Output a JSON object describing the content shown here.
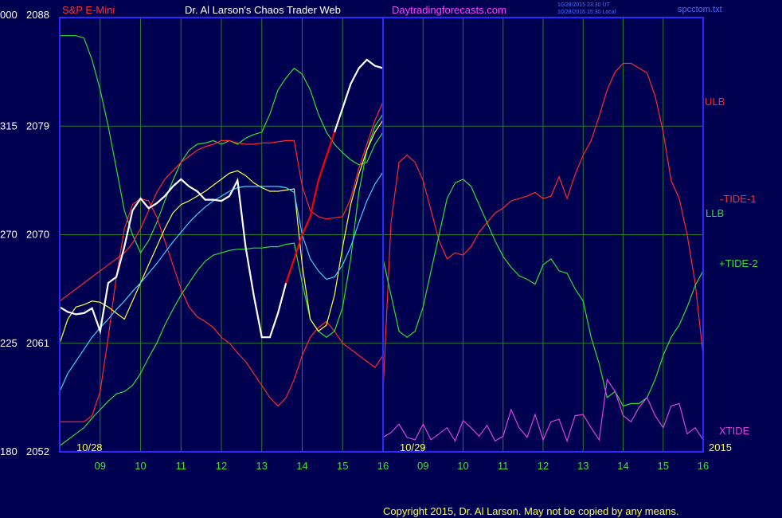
{
  "header": {
    "instrument": "S&P E-Mini",
    "title": "Dr. Al Larson's Chaos Trader Web",
    "site": "Daytradingforecasts.com",
    "timestamp1": "10/28/2015 23:30 UT",
    "timestamp2": "10/28/2015 15:30 Local",
    "filename": "spcctom.txt"
  },
  "footer": {
    "copyright": "Copyright 2015, Dr. Al Larson. May not be copied by any means."
  },
  "colors": {
    "background": "#000050",
    "plot_border": "#2a2aff",
    "grid": "#2a7a2a",
    "price_up": "#ffffff",
    "price_down": "#ff0000",
    "ulb": "#ff2a2a",
    "llb": "#30e030",
    "tide1": "#ff2a2a",
    "tide2": "#30e030",
    "xtide": "#e040e0",
    "ma_fast": "#ffff40",
    "ma_slow": "#40d0ff",
    "instrument_label": "#ff3030",
    "title_label": "#ffffff",
    "site_label": "#ff40ff",
    "axis_label": "#ffffff",
    "time_label": "#40e040"
  },
  "chart_data": {
    "type": "line",
    "title": "Dr. Al Larson's Chaos Trader Web",
    "y_ticks": [
      {
        "left": "000",
        "right": "2088",
        "value": 2088
      },
      {
        "left": "315",
        "right": "2079",
        "value": 2079
      },
      {
        "left": "270",
        "right": "2070",
        "value": 2070
      },
      {
        "left": "225",
        "right": "2061",
        "value": 2061
      },
      {
        "left": "180",
        "right": "2052",
        "value": 2052
      }
    ],
    "ylim": [
      2052,
      2088
    ],
    "xlim": [
      8.1,
      16.0
    ],
    "divider_x": 8.1,
    "dates": [
      {
        "label": "10/28",
        "x": 8.3
      },
      {
        "label": "10/29",
        "x": 8.4
      },
      {
        "label": "2015",
        "x": 16.0
      }
    ],
    "x_ticks_day1": [
      "09",
      "10",
      "11",
      "12",
      "13",
      "14",
      "15",
      "16"
    ],
    "x_ticks_day2": [
      "09",
      "10",
      "11",
      "12",
      "13",
      "14",
      "15",
      "16"
    ],
    "series": [
      {
        "name": "ULB",
        "color_key": "ulb",
        "day": 2,
        "x": [
          8.0,
          8.2,
          8.4,
          8.6,
          8.8,
          9.0,
          9.2,
          9.4,
          9.6,
          9.8,
          10.0,
          10.2,
          10.4,
          10.6,
          10.8,
          11.0,
          11.2,
          11.4,
          11.6,
          11.8,
          12.0,
          12.2,
          12.4,
          12.6,
          12.8,
          13.0,
          13.2,
          13.4,
          13.6,
          13.8,
          14.0,
          14.2,
          14.4,
          14.6,
          14.8,
          15.0,
          15.2,
          15.4,
          15.6,
          15.8,
          16.0
        ],
        "y": [
          2057.0,
          2071.0,
          2076.0,
          2076.6,
          2076.0,
          2074.5,
          2072.0,
          2069.5,
          2068.0,
          2068.5,
          2068.3,
          2069.0,
          2070.2,
          2071.0,
          2071.8,
          2072.2,
          2072.8,
          2073.0,
          2073.2,
          2073.5,
          2073.0,
          2073.2,
          2074.8,
          2073.0,
          2075.0,
          2076.6,
          2077.8,
          2079.8,
          2082.0,
          2083.5,
          2084.2,
          2084.2,
          2083.8,
          2083.4,
          2081.5,
          2078.5,
          2074.5,
          2073.0,
          2070.0,
          2066.0,
          2060.0
        ]
      },
      {
        "name": "LLB",
        "color_key": "llb",
        "day": 2,
        "x": [
          8.0,
          8.2,
          8.4,
          8.6,
          8.8,
          9.0,
          9.2,
          9.4,
          9.6,
          9.8,
          10.0,
          10.2,
          10.4,
          10.6,
          10.8,
          11.0,
          11.2,
          11.4,
          11.6,
          11.8,
          12.0,
          12.2,
          12.4,
          12.6,
          12.8,
          13.0,
          13.2,
          13.4,
          13.6,
          13.8,
          14.0,
          14.2,
          14.4,
          14.6,
          14.8,
          15.0,
          15.2,
          15.4,
          15.6,
          15.8,
          16.0
        ],
        "y": [
          2068.0,
          2065.0,
          2062.0,
          2061.5,
          2062.0,
          2064.0,
          2067.0,
          2070.0,
          2073.0,
          2074.3,
          2074.6,
          2074.0,
          2072.5,
          2071.0,
          2069.5,
          2068.2,
          2067.3,
          2066.6,
          2066.3,
          2065.9,
          2067.5,
          2068.0,
          2067.0,
          2066.8,
          2065.5,
          2064.5,
          2061.5,
          2059.3,
          2056.5,
          2057.0,
          2055.8,
          2056.0,
          2056.0,
          2056.5,
          2058.0,
          2060.0,
          2061.5,
          2062.5,
          2064.0,
          2065.8,
          2067.0
        ]
      },
      {
        "name": "XTIDE",
        "color_key": "xtide",
        "day": 2,
        "x": [
          8.0,
          8.2,
          8.4,
          8.6,
          8.8,
          9.0,
          9.2,
          9.4,
          9.6,
          9.8,
          10.0,
          10.2,
          10.4,
          10.6,
          10.8,
          11.0,
          11.2,
          11.4,
          11.6,
          11.8,
          12.0,
          12.2,
          12.4,
          12.6,
          12.8,
          13.0,
          13.2,
          13.4,
          13.6,
          13.8,
          14.0,
          14.2,
          14.4,
          14.6,
          14.8,
          15.0,
          15.2,
          15.4,
          15.6,
          15.8,
          16.0
        ],
        "y": [
          2053.2,
          2053.6,
          2054.3,
          2053.2,
          2053.0,
          2054.3,
          2053.0,
          2053.5,
          2054.0,
          2052.9,
          2054.6,
          2054.0,
          2053.3,
          2054.2,
          2052.9,
          2053.3,
          2055.5,
          2054.0,
          2053.2,
          2055.1,
          2053.0,
          2054.5,
          2054.7,
          2052.9,
          2055.0,
          2055.1,
          2054.0,
          2053.0,
          2058.0,
          2057.0,
          2055.0,
          2054.5,
          2055.7,
          2056.5,
          2055.0,
          2054.0,
          2055.8,
          2056.0,
          2053.5,
          2054.0,
          2053.0
        ]
      },
      {
        "name": "+TIDE-2",
        "color_key": "llb",
        "day": 1,
        "x": [
          8.0,
          8.2,
          8.4,
          8.6,
          8.8,
          9.0,
          9.2,
          9.4,
          9.6,
          9.8,
          10.0,
          10.2,
          10.4,
          10.6,
          10.8,
          11.0,
          11.2,
          11.4,
          11.6,
          11.8,
          12.0,
          12.2,
          12.4,
          12.6,
          12.8,
          13.0,
          13.2,
          13.4,
          13.6,
          13.8,
          14.0,
          14.2,
          14.4,
          14.6,
          14.8,
          15.0,
          15.2,
          15.4,
          15.6,
          15.8,
          16.0
        ],
        "y": [
          2086.5,
          2086.5,
          2086.5,
          2086.3,
          2084.5,
          2082.0,
          2079.0,
          2075.5,
          2072.0,
          2070.0,
          2068.5,
          2069.5,
          2071.0,
          2072.8,
          2074.5,
          2076.0,
          2077.0,
          2077.5,
          2077.6,
          2077.8,
          2077.5,
          2077.8,
          2077.5,
          2078.0,
          2078.3,
          2078.5,
          2080.0,
          2082.0,
          2083.0,
          2083.8,
          2083.3,
          2082.0,
          2080.0,
          2078.5,
          2077.5,
          2076.8,
          2076.2,
          2075.8,
          2076.0,
          2077.5,
          2078.5
        ]
      },
      {
        "name": "-TIDE-1",
        "color_key": "tide1",
        "day": 1,
        "x": [
          8.0,
          8.2,
          8.4,
          8.6,
          8.8,
          9.0,
          9.2,
          9.4,
          9.6,
          9.8,
          10.0,
          10.2,
          10.4,
          10.6,
          10.8,
          11.0,
          11.2,
          11.4,
          11.6,
          11.8,
          12.0,
          12.2,
          12.4,
          12.6,
          12.8,
          13.0,
          13.2,
          13.4,
          13.6,
          13.8,
          14.0,
          14.2,
          14.4,
          14.6,
          14.8,
          15.0,
          15.2,
          15.4,
          15.6,
          15.8,
          16.0
        ],
        "y": [
          2054.5,
          2054.5,
          2054.5,
          2054.5,
          2055.0,
          2057.0,
          2061.5,
          2066.5,
          2070.5,
          2072.5,
          2073.0,
          2072.8,
          2071.5,
          2069.5,
          2067.5,
          2065.5,
          2064.0,
          2063.2,
          2062.8,
          2062.3,
          2061.5,
          2061.0,
          2060.2,
          2059.5,
          2058.5,
          2057.5,
          2056.5,
          2055.8,
          2056.5,
          2058.0,
          2060.0,
          2061.5,
          2062.3,
          2062.8,
          2062.0,
          2061.0,
          2060.5,
          2060.0,
          2059.5,
          2059.0,
          2060.0
        ]
      },
      {
        "name": "LLB",
        "color_key": "llb",
        "day": 1,
        "x": [
          8.0,
          8.2,
          8.4,
          8.6,
          8.8,
          9.0,
          9.2,
          9.4,
          9.6,
          9.8,
          10.0,
          10.2,
          10.4,
          10.6,
          10.8,
          11.0,
          11.2,
          11.4,
          11.6,
          11.8,
          12.0,
          12.2,
          12.4,
          12.6,
          12.8,
          13.0,
          13.2,
          13.4,
          13.6,
          13.8,
          14.0,
          14.2,
          14.4,
          14.6,
          14.8,
          15.0,
          15.2,
          15.4,
          15.6,
          15.8,
          16.0
        ],
        "y": [
          2052.5,
          2053.0,
          2053.5,
          2054.0,
          2054.8,
          2055.5,
          2056.2,
          2056.8,
          2057.0,
          2057.5,
          2058.5,
          2059.8,
          2061.0,
          2062.5,
          2063.8,
          2065.0,
          2066.0,
          2067.0,
          2067.8,
          2068.3,
          2068.5,
          2068.7,
          2068.8,
          2068.8,
          2068.9,
          2068.9,
          2069.0,
          2069.0,
          2069.2,
          2069.3,
          2066.0,
          2063.0,
          2062.0,
          2061.5,
          2062.0,
          2064.0,
          2068.0,
          2073.5,
          2077.0,
          2079.0,
          2080.0
        ]
      },
      {
        "name": "ULB",
        "color_key": "ulb",
        "day": 1,
        "x": [
          8.0,
          8.2,
          8.4,
          8.6,
          8.8,
          9.0,
          9.2,
          9.4,
          9.6,
          9.8,
          10.0,
          10.2,
          10.4,
          10.6,
          10.8,
          11.0,
          11.2,
          11.4,
          11.6,
          11.8,
          12.0,
          12.2,
          12.4,
          12.6,
          12.8,
          13.0,
          13.2,
          13.4,
          13.6,
          13.8,
          14.0,
          14.2,
          14.4,
          14.6,
          14.8,
          15.0,
          15.2,
          15.4,
          15.6,
          15.8,
          16.0
        ],
        "y": [
          2064.5,
          2065.0,
          2065.5,
          2066.0,
          2066.5,
          2067.0,
          2067.5,
          2068.0,
          2068.5,
          2069.3,
          2070.5,
          2072.0,
          2073.5,
          2074.6,
          2075.3,
          2076.0,
          2076.5,
          2077.0,
          2077.3,
          2077.5,
          2077.8,
          2077.8,
          2077.6,
          2077.5,
          2077.5,
          2077.6,
          2077.6,
          2077.7,
          2077.8,
          2077.8,
          2074.0,
          2072.0,
          2071.5,
          2071.3,
          2071.4,
          2071.5,
          2073.0,
          2075.5,
          2077.5,
          2079.5,
          2081.0
        ]
      },
      {
        "name": "MA-FAST",
        "color_key": "ma_fast",
        "day": 1,
        "x": [
          8.0,
          8.2,
          8.4,
          8.6,
          8.8,
          9.0,
          9.2,
          9.4,
          9.6,
          9.8,
          10.0,
          10.2,
          10.4,
          10.6,
          10.8,
          11.0,
          11.2,
          11.4,
          11.6,
          11.8,
          12.0,
          12.2,
          12.4,
          12.6,
          12.8,
          13.0,
          13.2,
          13.4,
          13.6,
          13.8,
          14.0,
          14.2,
          14.4,
          14.6,
          14.8,
          15.0,
          15.2,
          15.4,
          15.6,
          15.8,
          16.0
        ],
        "y": [
          2061.0,
          2063.0,
          2064.0,
          2064.2,
          2064.5,
          2064.4,
          2064.0,
          2063.5,
          2063.0,
          2064.5,
          2066.0,
          2067.5,
          2069.0,
          2070.5,
          2071.8,
          2072.5,
          2072.8,
          2073.2,
          2073.6,
          2074.1,
          2074.6,
          2075.1,
          2075.3,
          2074.9,
          2074.3,
          2073.9,
          2073.6,
          2073.6,
          2073.7,
          2073.8,
          2067.5,
          2063.0,
          2062.0,
          2062.5,
          2065.0,
          2069.0,
          2072.5,
          2075.0,
          2077.0,
          2078.5,
          2079.5
        ]
      },
      {
        "name": "MA-SLOW",
        "color_key": "ma_slow",
        "day": 1,
        "x": [
          8.0,
          8.2,
          8.4,
          8.6,
          8.8,
          9.0,
          9.2,
          9.4,
          9.6,
          9.8,
          10.0,
          10.2,
          10.4,
          10.6,
          10.8,
          11.0,
          11.2,
          11.4,
          11.6,
          11.8,
          12.0,
          12.2,
          12.4,
          12.6,
          12.8,
          13.0,
          13.2,
          13.4,
          13.6,
          13.8,
          14.0,
          14.2,
          14.4,
          14.6,
          14.8,
          15.0,
          15.2,
          15.4,
          15.6,
          15.8,
          16.0
        ],
        "y": [
          2057.0,
          2058.5,
          2059.5,
          2060.5,
          2061.5,
          2062.3,
          2063.0,
          2063.8,
          2064.5,
          2065.3,
          2066.0,
          2066.8,
          2067.6,
          2068.5,
          2069.4,
          2070.2,
          2071.0,
          2071.7,
          2072.3,
          2072.8,
          2073.2,
          2073.6,
          2073.9,
          2074.0,
          2074.0,
          2074.0,
          2074.0,
          2074.0,
          2073.9,
          2073.5,
          2070.0,
          2068.0,
          2067.0,
          2066.3,
          2066.5,
          2067.5,
          2069.0,
          2071.0,
          2072.8,
          2074.2,
          2075.2
        ]
      }
    ],
    "price": {
      "name": "S&P E-Mini",
      "day": 1,
      "x": [
        8.0,
        8.2,
        8.4,
        8.6,
        8.8,
        9.0,
        9.2,
        9.4,
        9.6,
        9.8,
        10.0,
        10.2,
        10.4,
        10.6,
        10.8,
        11.0,
        11.2,
        11.4,
        11.6,
        11.8,
        12.0,
        12.2,
        12.4,
        12.6,
        12.8,
        13.0,
        13.2,
        13.4,
        13.6,
        13.8,
        14.0,
        14.2,
        14.4,
        14.6,
        14.8,
        15.0,
        15.2,
        15.4,
        15.6,
        15.8,
        16.0
      ],
      "y": [
        2064.0,
        2063.6,
        2063.4,
        2063.5,
        2063.9,
        2062.0,
        2066.0,
        2066.5,
        2069.0,
        2072.0,
        2073.0,
        2072.2,
        2072.6,
        2073.2,
        2074.0,
        2074.6,
        2074.0,
        2073.6,
        2072.9,
        2072.9,
        2072.8,
        2073.2,
        2074.5,
        2069.0,
        2065.0,
        2061.5,
        2061.5,
        2063.5,
        2066.0,
        2068.0,
        2070.0,
        2071.5,
        2074.5,
        2076.5,
        2078.5,
        2080.5,
        2082.5,
        2083.8,
        2084.5,
        2084.0,
        2083.8
      ],
      "down_x_range": [
        13.8,
        14.7
      ]
    },
    "annotations": [
      {
        "text": "ULB",
        "color_key": "ulb"
      },
      {
        "text": "-TIDE-1",
        "color_key": "tide1"
      },
      {
        "text": "LLB",
        "color_key": "llb"
      },
      {
        "text": "+TIDE-2",
        "color_key": "tide2"
      },
      {
        "text": "XTIDE",
        "color_key": "xtide"
      }
    ]
  }
}
